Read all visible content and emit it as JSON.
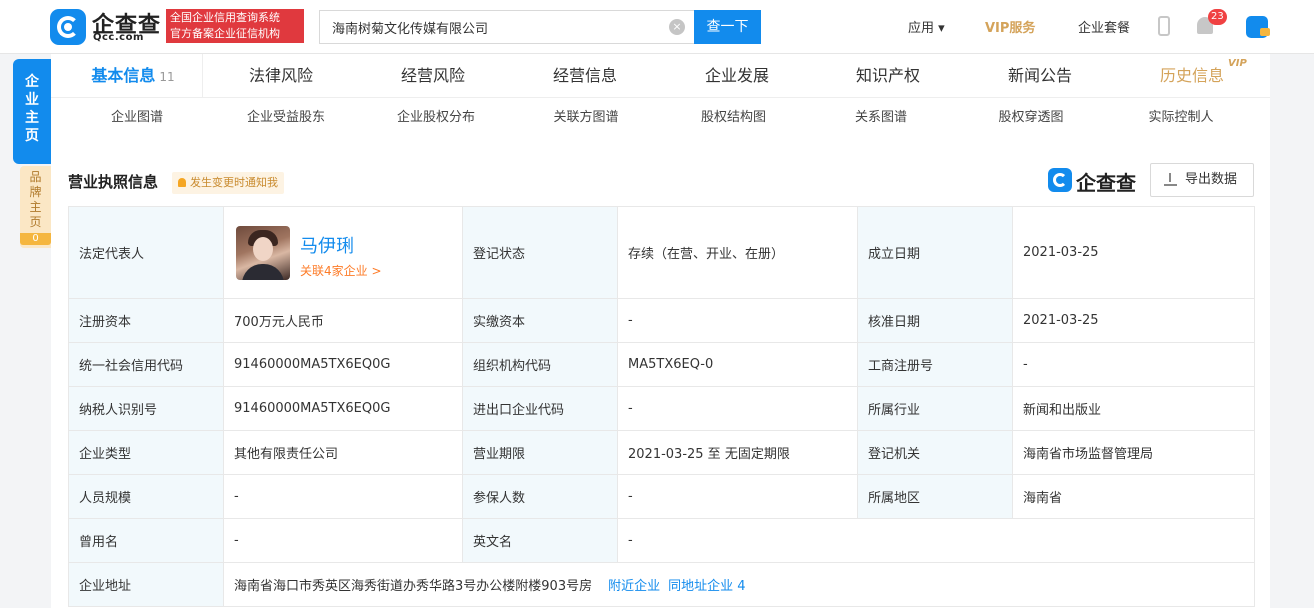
{
  "header": {
    "logo_text": "企查查",
    "logo_sub": "Qcc.com",
    "cert_line1": "全国企业信用查询系统",
    "cert_line2": "官方备案企业征信机构",
    "search_value": "海南树菊文化传媒有限公司",
    "search_button": "查一下",
    "nav_app": "应用 ▾",
    "nav_vip": "VIP服务",
    "nav_package": "企业套餐",
    "notification_count": "23"
  },
  "side": {
    "main_tab": "企业主页",
    "brand_tab": "品牌主页",
    "brand_count": "0"
  },
  "tabs": [
    {
      "label": "基本信息",
      "count": "11"
    },
    {
      "label": "法律风险"
    },
    {
      "label": "经营风险"
    },
    {
      "label": "经营信息"
    },
    {
      "label": "企业发展"
    },
    {
      "label": "知识产权"
    },
    {
      "label": "新闻公告"
    },
    {
      "label": "历史信息",
      "badge": "VIP"
    }
  ],
  "subtabs": [
    "企业图谱",
    "企业受益股东",
    "企业股权分布",
    "关联方图谱",
    "股权结构图",
    "关系图谱",
    "股权穿透图",
    "实际控制人"
  ],
  "section": {
    "title": "营业执照信息",
    "notify": "发生变更时通知我",
    "brand": "企查查",
    "export": "导出数据"
  },
  "info": {
    "legal_rep_label": "法定代表人",
    "legal_rep_name": "马伊琍",
    "legal_rep_link": "关联4家企业 >",
    "reg_status_label": "登记状态",
    "reg_status": "存续（在营、开业、在册）",
    "est_date_label": "成立日期",
    "est_date": "2021-03-25",
    "reg_capital_label": "注册资本",
    "reg_capital": "700万元人民币",
    "paid_capital_label": "实缴资本",
    "paid_capital": "-",
    "approve_date_label": "核准日期",
    "approve_date": "2021-03-25",
    "credit_code_label": "统一社会信用代码",
    "credit_code": "91460000MA5TX6EQ0G",
    "org_code_label": "组织机构代码",
    "org_code": "MA5TX6EQ-0",
    "biz_reg_label": "工商注册号",
    "biz_reg": "-",
    "tax_id_label": "纳税人识别号",
    "tax_id": "91460000MA5TX6EQ0G",
    "import_export_label": "进出口企业代码",
    "import_export": "-",
    "industry_label": "所属行业",
    "industry": "新闻和出版业",
    "type_label": "企业类型",
    "type": "其他有限责任公司",
    "term_label": "营业期限",
    "term": "2021-03-25 至 无固定期限",
    "authority_label": "登记机关",
    "authority": "海南省市场监督管理局",
    "staff_label": "人员规模",
    "staff": "-",
    "insured_label": "参保人数",
    "insured": "-",
    "region_label": "所属地区",
    "region": "海南省",
    "former_name_label": "曾用名",
    "former_name": "-",
    "english_name_label": "英文名",
    "english_name": "-",
    "address_label": "企业地址",
    "address": "海南省海口市秀英区海秀街道办秀华路3号办公楼附楼903号房",
    "nearby": "附近企业",
    "same_address": "同地址企业 4"
  }
}
